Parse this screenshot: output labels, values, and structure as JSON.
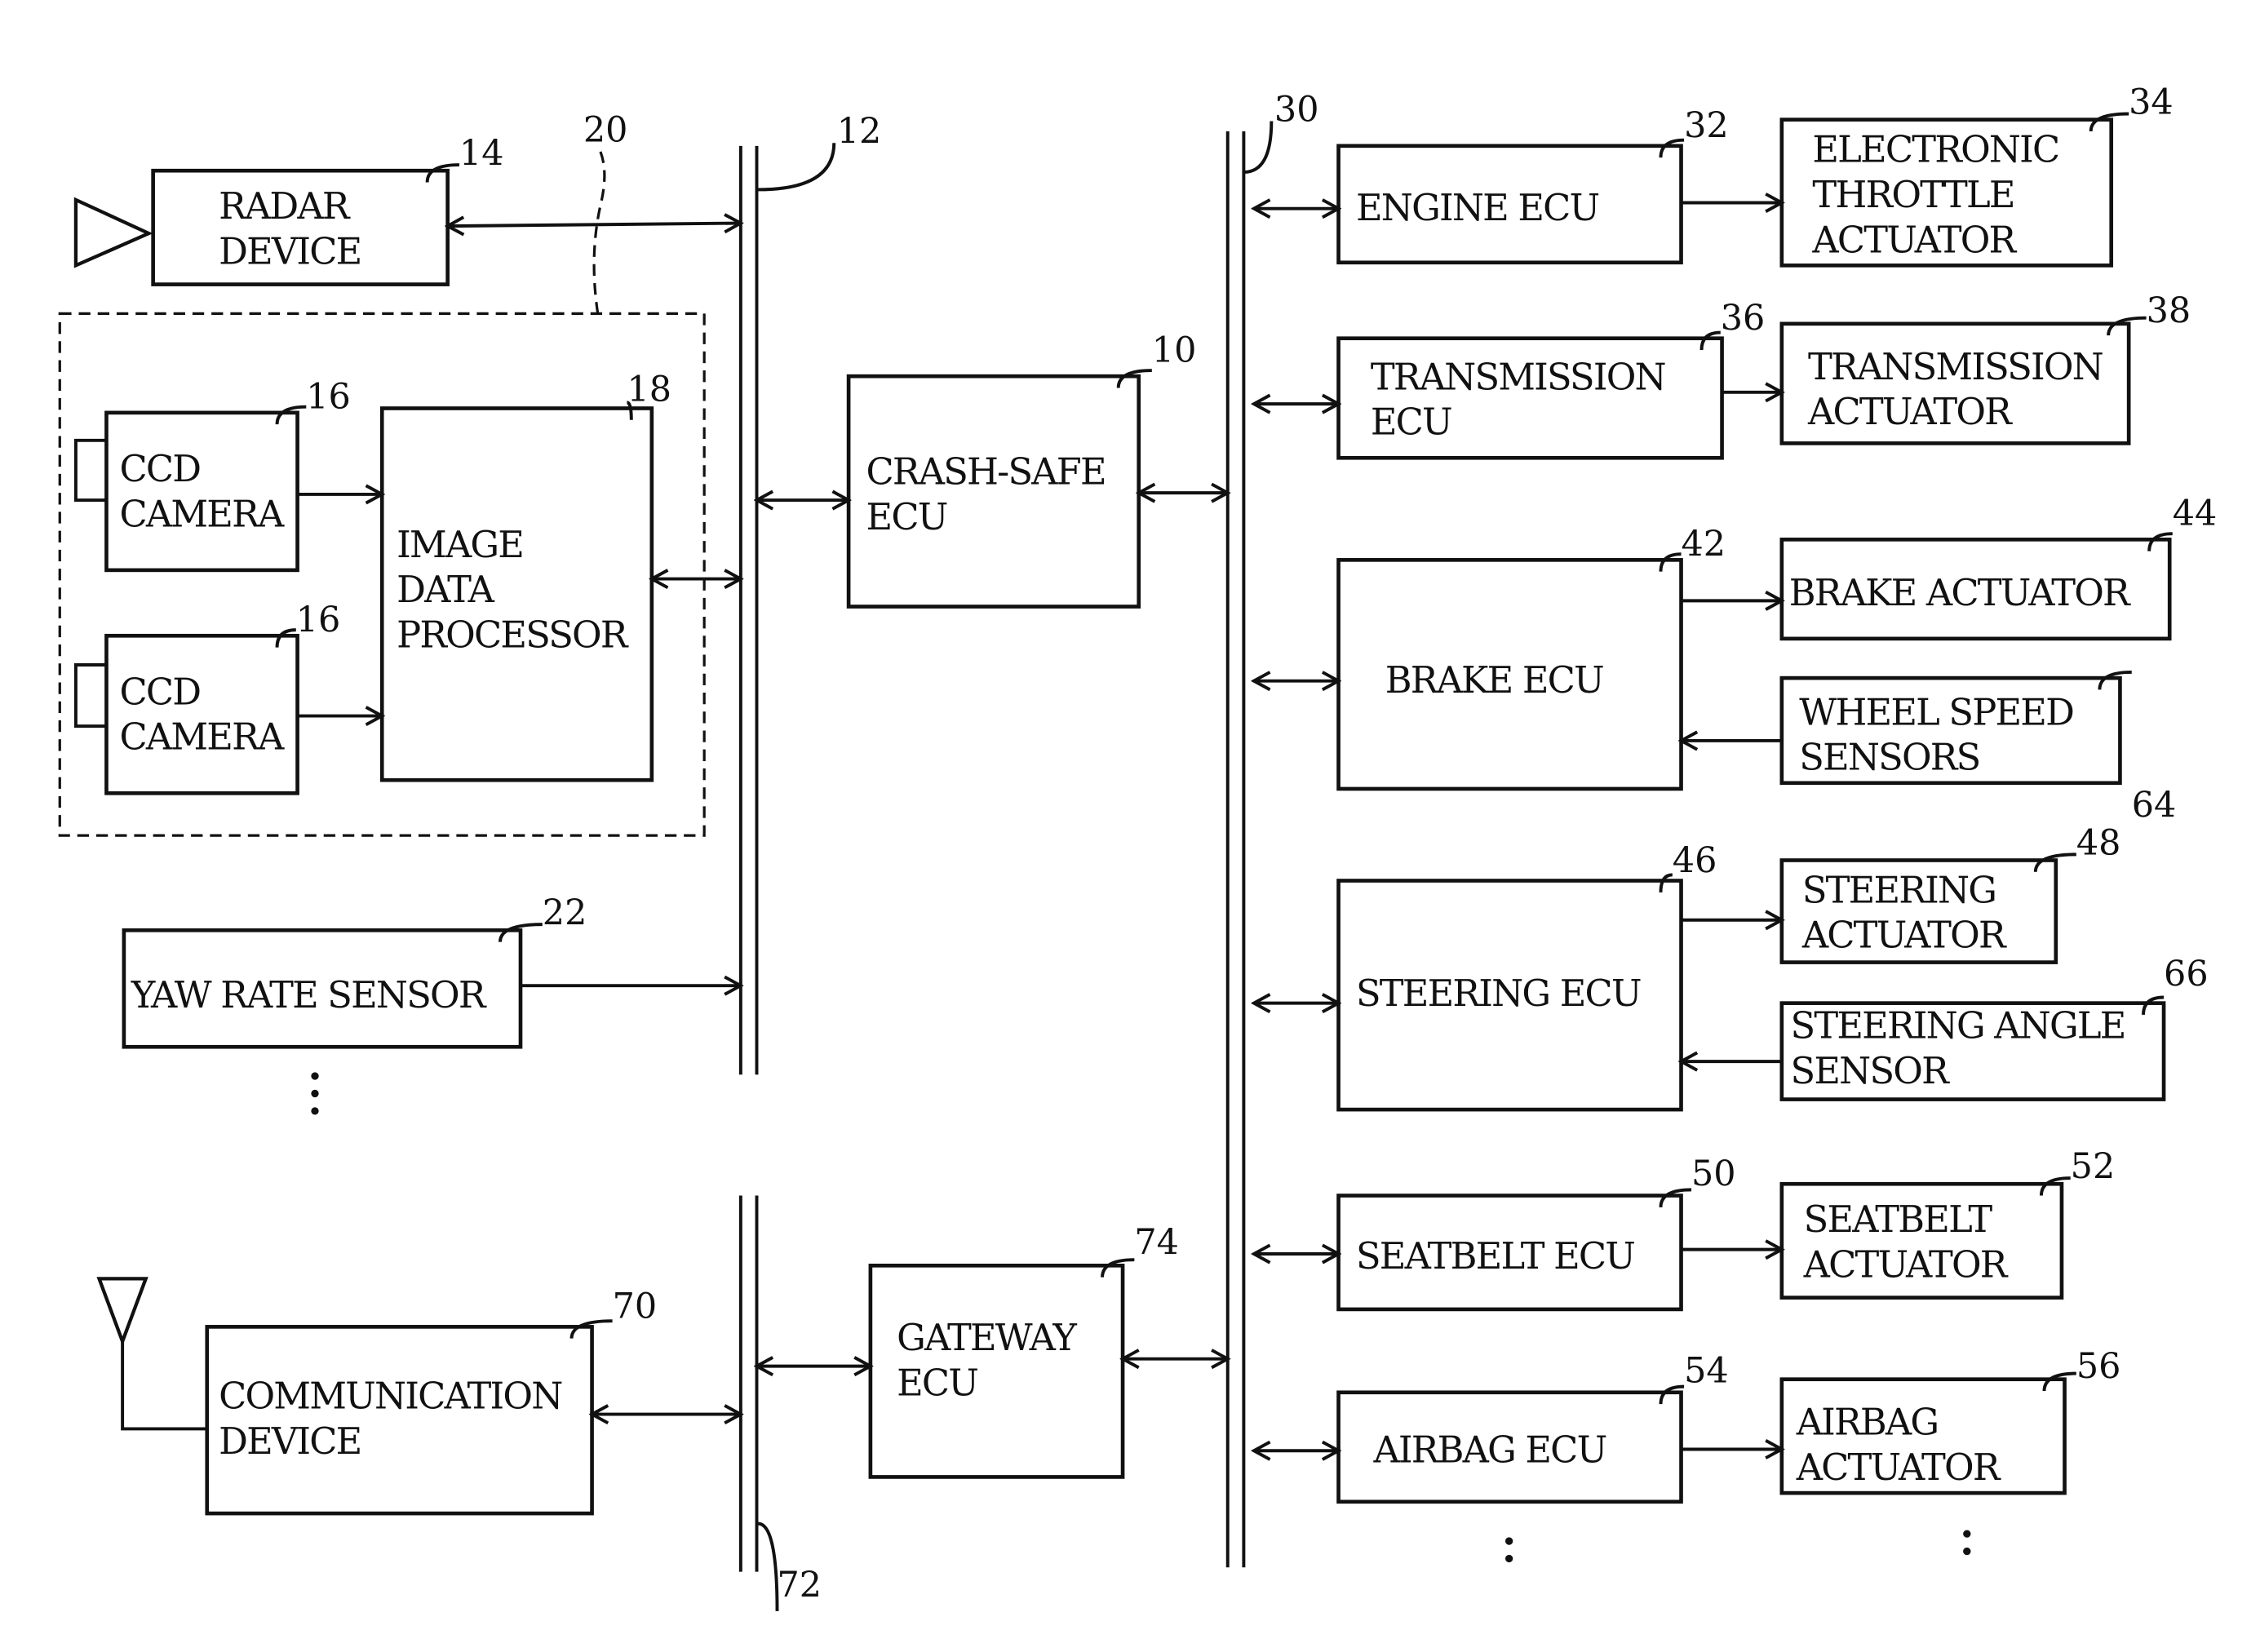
{
  "diagram": {
    "type": "block-diagram",
    "buses": [
      {
        "id": "bus-12",
        "ref": "12"
      },
      {
        "id": "bus-30",
        "ref": "30"
      },
      {
        "id": "bus-72",
        "ref": "72"
      }
    ],
    "blocks": [
      {
        "id": "radar",
        "ref": "14",
        "lines": [
          "RADAR",
          "DEVICE"
        ]
      },
      {
        "id": "group20",
        "ref": "20"
      },
      {
        "id": "cam1",
        "ref": "16",
        "lines": [
          "CCD",
          "CAMERA"
        ]
      },
      {
        "id": "cam2",
        "ref": "16",
        "lines": [
          "CCD",
          "CAMERA"
        ]
      },
      {
        "id": "imgproc",
        "ref": "18",
        "lines": [
          "IMAGE",
          "DATA",
          "PROCESSOR"
        ]
      },
      {
        "id": "yaw",
        "ref": "22",
        "lines": [
          "YAW RATE SENSOR"
        ]
      },
      {
        "id": "crash",
        "ref": "10",
        "lines": [
          "CRASH-SAFE",
          "ECU"
        ]
      },
      {
        "id": "comm",
        "ref": "70",
        "lines": [
          "COMMUNICATION",
          "DEVICE"
        ]
      },
      {
        "id": "gateway",
        "ref": "74",
        "lines": [
          "GATEWAY",
          "ECU"
        ]
      },
      {
        "id": "engine",
        "ref": "32",
        "lines": [
          "ENGINE ECU"
        ]
      },
      {
        "id": "throttle",
        "ref": "34",
        "lines": [
          "ELECTRONIC",
          "THROTTLE",
          "ACTUATOR"
        ]
      },
      {
        "id": "trans",
        "ref": "36",
        "lines": [
          "TRANSMISSION",
          "ECU"
        ]
      },
      {
        "id": "transact",
        "ref": "38",
        "lines": [
          "TRANSMISSION",
          "ACTUATOR"
        ]
      },
      {
        "id": "brake",
        "ref": "42",
        "lines": [
          "BRAKE ECU"
        ]
      },
      {
        "id": "brakeact",
        "ref": "44",
        "lines": [
          "BRAKE ACTUATOR"
        ]
      },
      {
        "id": "wheel",
        "ref": "64",
        "lines": [
          "WHEEL SPEED",
          "SENSORS"
        ]
      },
      {
        "id": "steer",
        "ref": "46",
        "lines": [
          "STEERING ECU"
        ]
      },
      {
        "id": "steeract",
        "ref": "48",
        "lines": [
          "STEERING",
          "ACTUATOR"
        ]
      },
      {
        "id": "steerangle",
        "ref": "66",
        "lines": [
          "STEERING ANGLE",
          "SENSOR"
        ]
      },
      {
        "id": "seatbelt",
        "ref": "50",
        "lines": [
          "SEATBELT ECU"
        ]
      },
      {
        "id": "seatbeltact",
        "ref": "52",
        "lines": [
          "SEATBELT",
          "ACTUATOR"
        ]
      },
      {
        "id": "airbag",
        "ref": "54",
        "lines": [
          "AIRBAG ECU"
        ]
      },
      {
        "id": "airbagact",
        "ref": "56",
        "lines": [
          "AIRBAG",
          "ACTUATOR"
        ]
      }
    ],
    "ellipsis": ":"
  }
}
